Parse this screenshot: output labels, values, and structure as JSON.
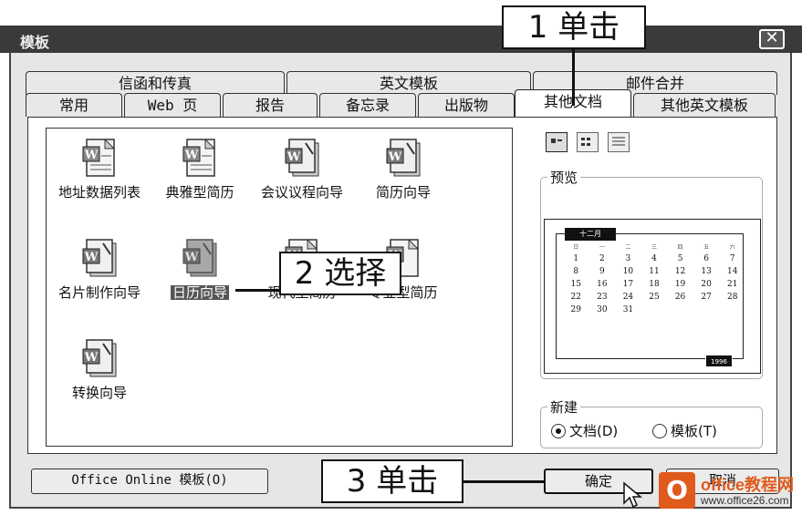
{
  "window": {
    "title": "模板",
    "close_glyph": "✕"
  },
  "tabs": {
    "back_row": [
      "信函和传真",
      "英文模板",
      "邮件合并"
    ],
    "front_row": [
      "常用",
      "Web 页",
      "报告",
      "备忘录",
      "出版物",
      "其他文档",
      "其他英文模板"
    ],
    "active": "其他文档"
  },
  "items": [
    {
      "label": "地址数据列表",
      "icon": "word-document-icon"
    },
    {
      "label": "典雅型简历",
      "icon": "word-document-icon"
    },
    {
      "label": "会议议程向导",
      "icon": "word-wizard-icon"
    },
    {
      "label": "简历向导",
      "icon": "word-wizard-icon"
    },
    {
      "label": "名片制作向导",
      "icon": "word-wizard-icon"
    },
    {
      "label": "日历向导",
      "icon": "word-wizard-icon",
      "selected": true
    },
    {
      "label": "现代型简历",
      "icon": "word-document-icon"
    },
    {
      "label": "专业型简历",
      "icon": "word-document-icon"
    },
    {
      "label": "转换向导",
      "icon": "word-wizard-icon"
    }
  ],
  "view_buttons": [
    "large-icons-view-icon",
    "list-view-icon",
    "details-view-icon"
  ],
  "preview": {
    "label": "预览",
    "calendar_header": "十二月",
    "weekdays": [
      "日",
      "一",
      "二",
      "三",
      "四",
      "五",
      "六"
    ],
    "days": [
      "1",
      "2",
      "3",
      "4",
      "5",
      "6",
      "7",
      "8",
      "9",
      "10",
      "11",
      "12",
      "13",
      "14",
      "15",
      "16",
      "17",
      "18",
      "19",
      "20",
      "21",
      "22",
      "23",
      "24",
      "25",
      "26",
      "27",
      "28",
      "29",
      "30",
      "31"
    ],
    "year": "1996"
  },
  "new_group": {
    "label": "新建",
    "options": [
      {
        "label": "文档(D)",
        "checked": true
      },
      {
        "label": "模板(T)",
        "checked": false
      }
    ]
  },
  "buttons": {
    "office_online": "Office Online 模板(O)",
    "ok": "确定",
    "cancel": "取消"
  },
  "callouts": {
    "step1": "1 单击",
    "step2": "2 选择",
    "step3": "3 单击"
  },
  "watermark": {
    "brand": "office教程网",
    "url": "www.office26.com",
    "mark": "O"
  },
  "colors": {
    "selection": "#555555",
    "watermark": "#e05a1c"
  }
}
